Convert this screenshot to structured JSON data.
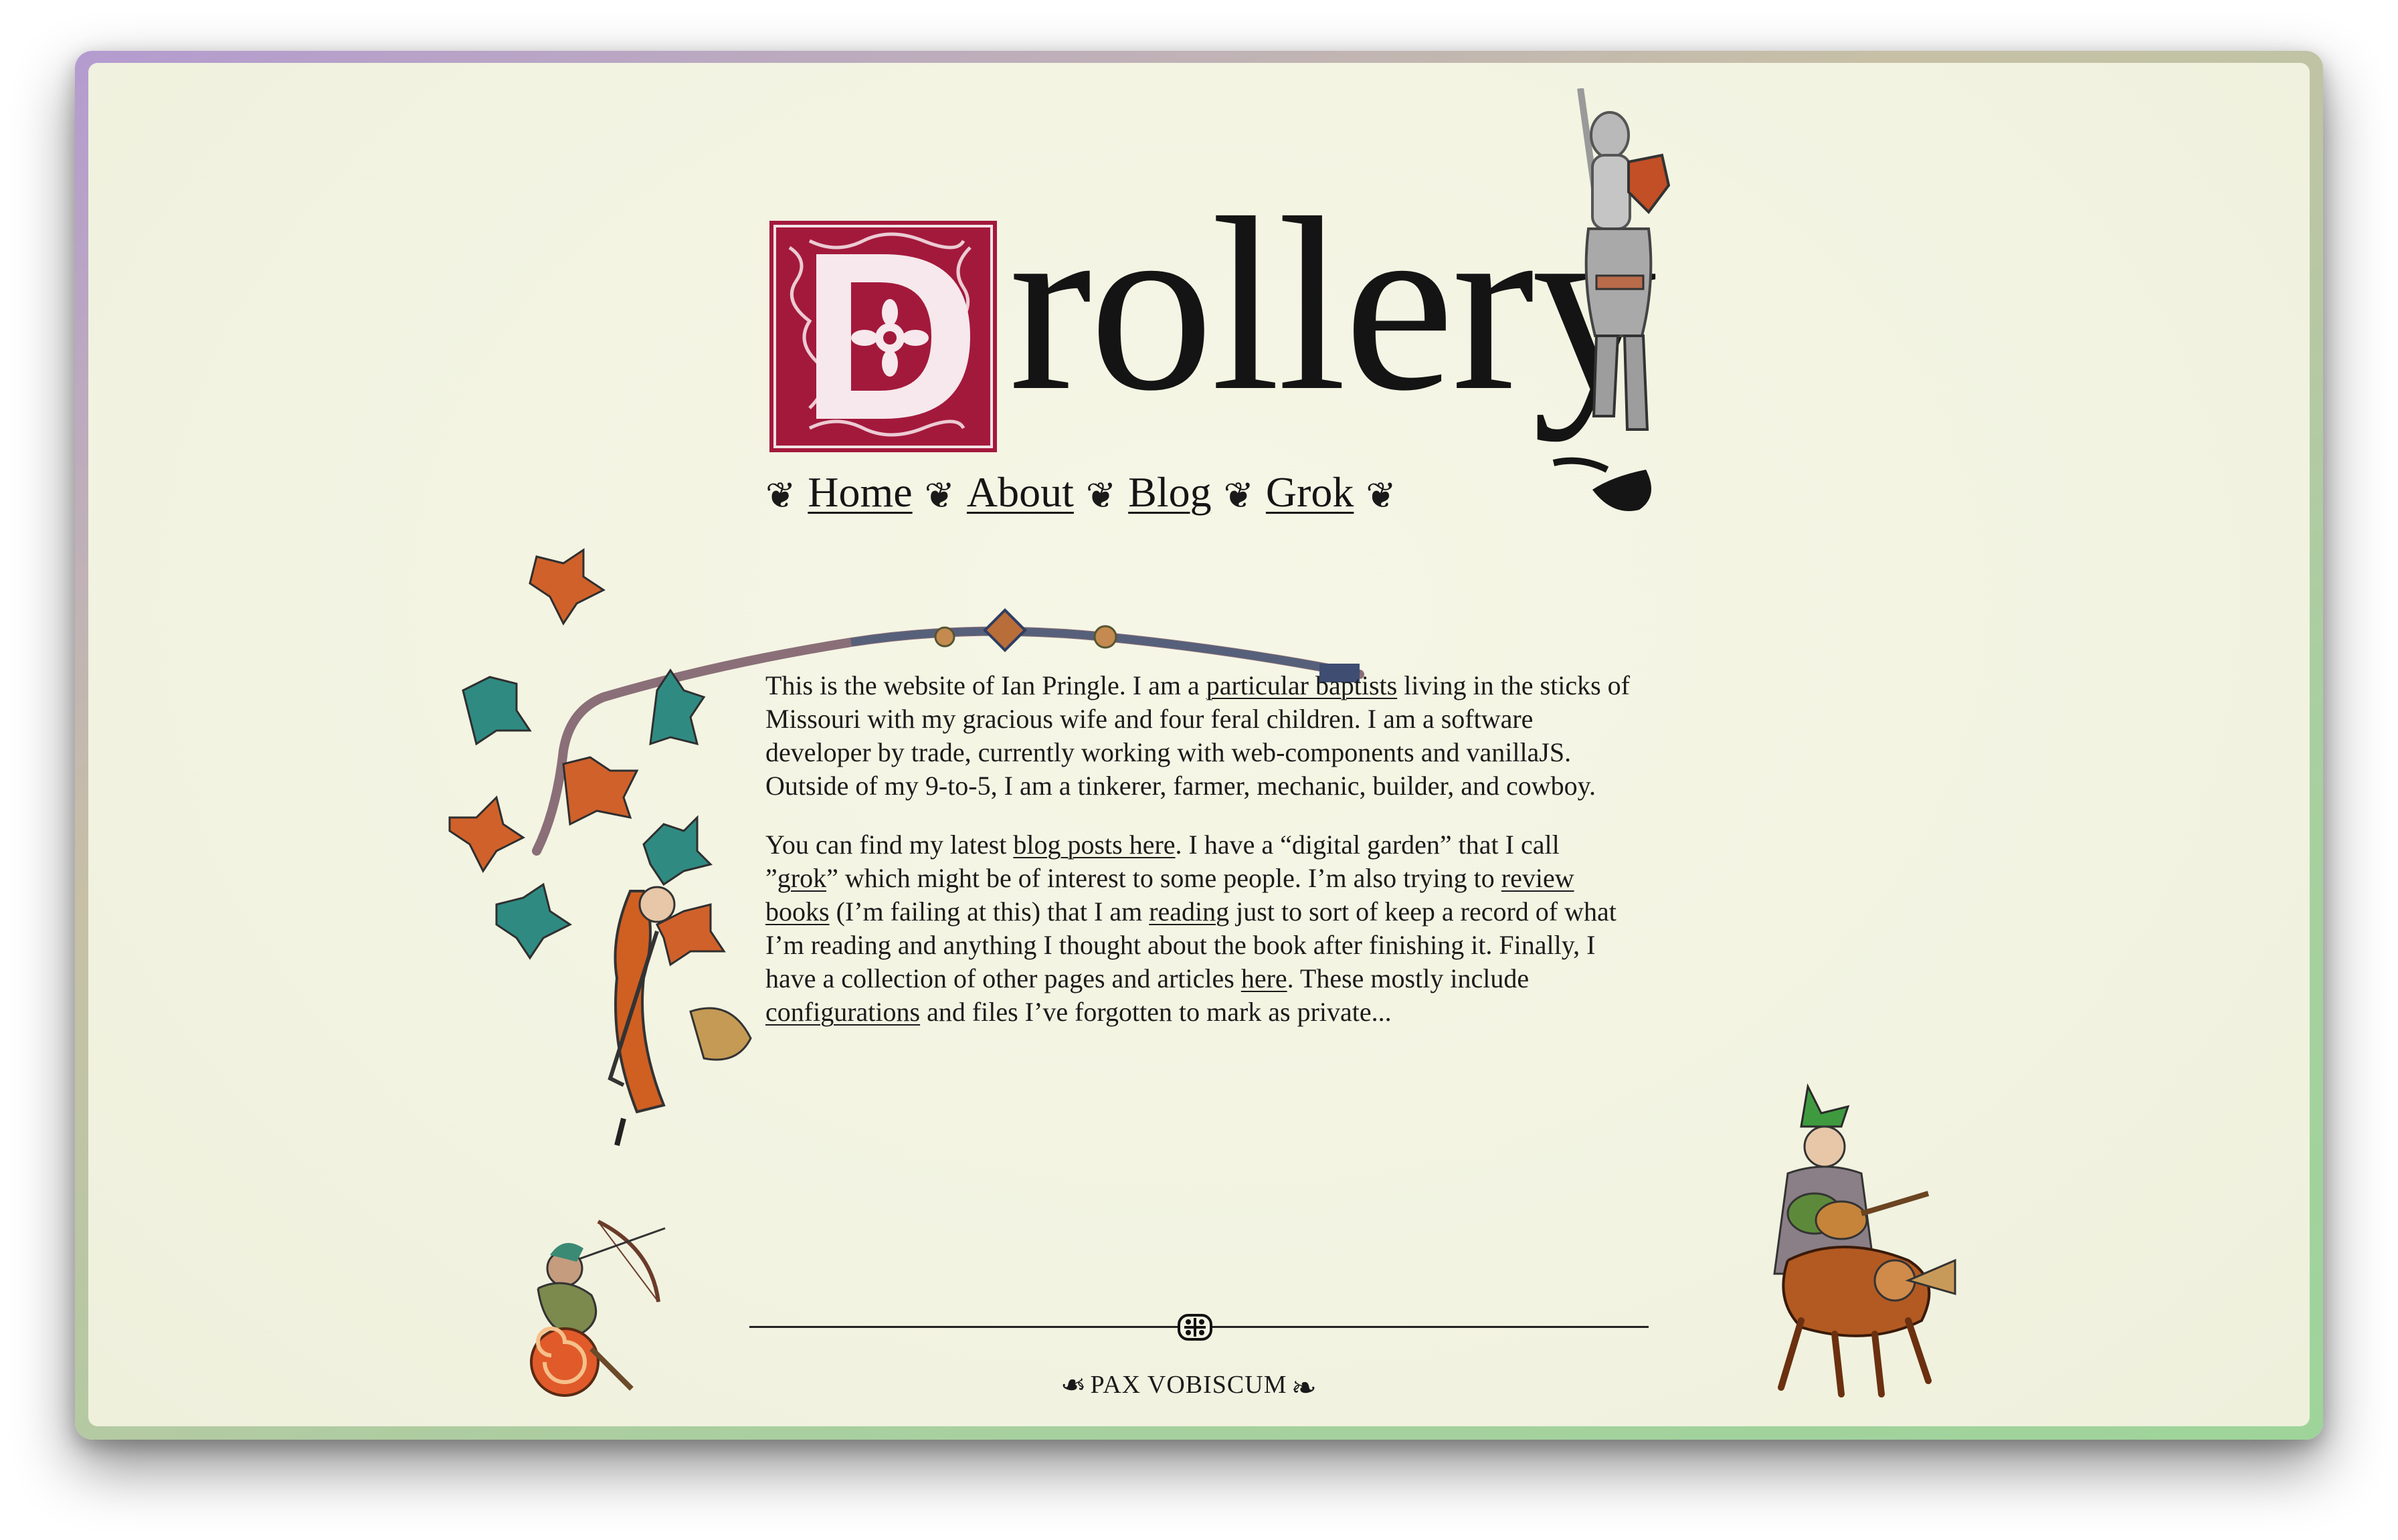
{
  "site": {
    "title_initial": "D",
    "title_rest": "rollery"
  },
  "nav": {
    "items": [
      {
        "label": "Home"
      },
      {
        "label": "About"
      },
      {
        "label": "Blog"
      },
      {
        "label": "Grok"
      }
    ],
    "separator_icon": "fleuron-icon"
  },
  "content": {
    "para1": {
      "t1": "This is the website of Ian Pringle. I am a ",
      "link1": "particular baptists",
      "t2": " living in the sticks of Missouri with my gracious wife and four feral children. I am a software developer by trade, currently working with web-components and vanillaJS. Outside of my 9-to-5, I am a tinkerer, farmer, mechanic, builder, and cowboy."
    },
    "para2": {
      "t1": "You can find my latest ",
      "link_blog": "blog posts here",
      "t2": ". I have a “digital garden” that I call ”",
      "link_grok": "grok",
      "t3": "” which might be of interest to some people. I’m also trying to ",
      "link_review": "review books",
      "t4": " (I’m failing at this) that I am ",
      "link_reading": "reading",
      "t5": " just to sort of keep a record of what I’m reading and anything I thought about the book after finishing it. Finally, I have a collection of other pages and articles ",
      "link_here": "here",
      "t6": ". These mostly include ",
      "link_config": "configurations",
      "t7": " and files I’ve forgotten to mark as private..."
    }
  },
  "footer": {
    "motto": "PAX VOBISCUM"
  },
  "illustrations": {
    "knight": "knight-on-horse-icon",
    "vine": "flowering-vine-icon",
    "climber": "climbing-monk-icon",
    "archer": "snail-archer-icon",
    "lute_player": "lute-player-on-beast-icon"
  },
  "colors": {
    "initial_red": "#a3193c",
    "ink": "#151515",
    "parchment": "#f3f4e2"
  }
}
